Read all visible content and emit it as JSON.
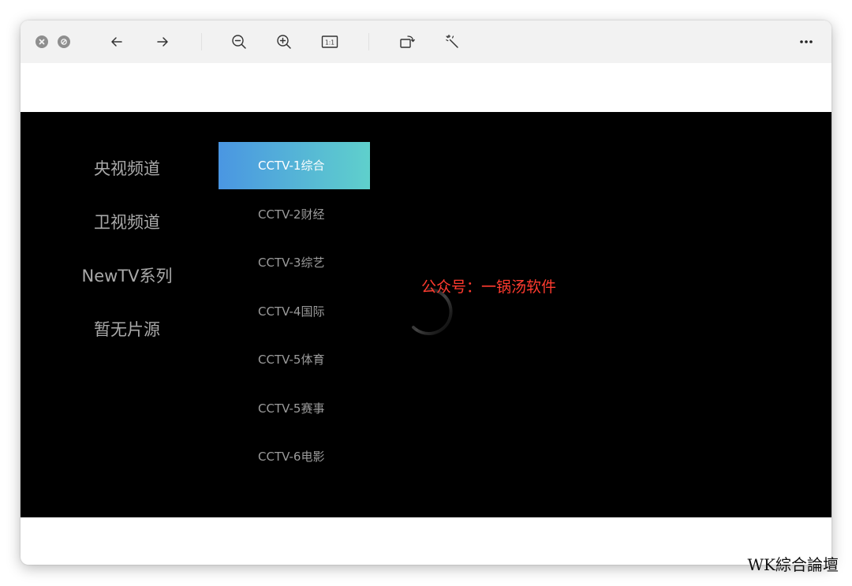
{
  "toolbar": {
    "buttons": [
      {
        "name": "close-window",
        "icon": "close-circle-icon"
      },
      {
        "name": "minimize-window",
        "icon": "block-circle-icon"
      },
      {
        "name": "back",
        "icon": "arrow-left-icon"
      },
      {
        "name": "forward",
        "icon": "arrow-right-icon"
      },
      {
        "name": "zoom-out",
        "icon": "zoom-out-icon"
      },
      {
        "name": "zoom-in",
        "icon": "zoom-in-icon"
      },
      {
        "name": "actual-size",
        "icon": "actual-size-icon",
        "label": "1:1"
      },
      {
        "name": "rotate",
        "icon": "rotate-icon"
      },
      {
        "name": "enhance",
        "icon": "magic-wand-icon"
      },
      {
        "name": "more",
        "icon": "more-horizontal-icon"
      }
    ]
  },
  "categories": [
    "央视频道",
    "卫视频道",
    "NewTV系列",
    "暂无片源"
  ],
  "channels": [
    {
      "label": "CCTV-1综合",
      "active": true
    },
    {
      "label": "CCTV-2财经",
      "active": false
    },
    {
      "label": "CCTV-3综艺",
      "active": false
    },
    {
      "label": "CCTV-4国际",
      "active": false
    },
    {
      "label": "CCTV-5体育",
      "active": false
    },
    {
      "label": "CCTV-5赛事",
      "active": false
    },
    {
      "label": "CCTV-6电影",
      "active": false
    }
  ],
  "overlay_text": "公众号：一锅汤软件",
  "corner_watermark": "WK綜合論壇",
  "colors": {
    "active_gradient_start": "#4a96e2",
    "active_gradient_end": "#5fd0cc",
    "overlay_red": "#ff3b2f",
    "stage_background": "#000000"
  }
}
